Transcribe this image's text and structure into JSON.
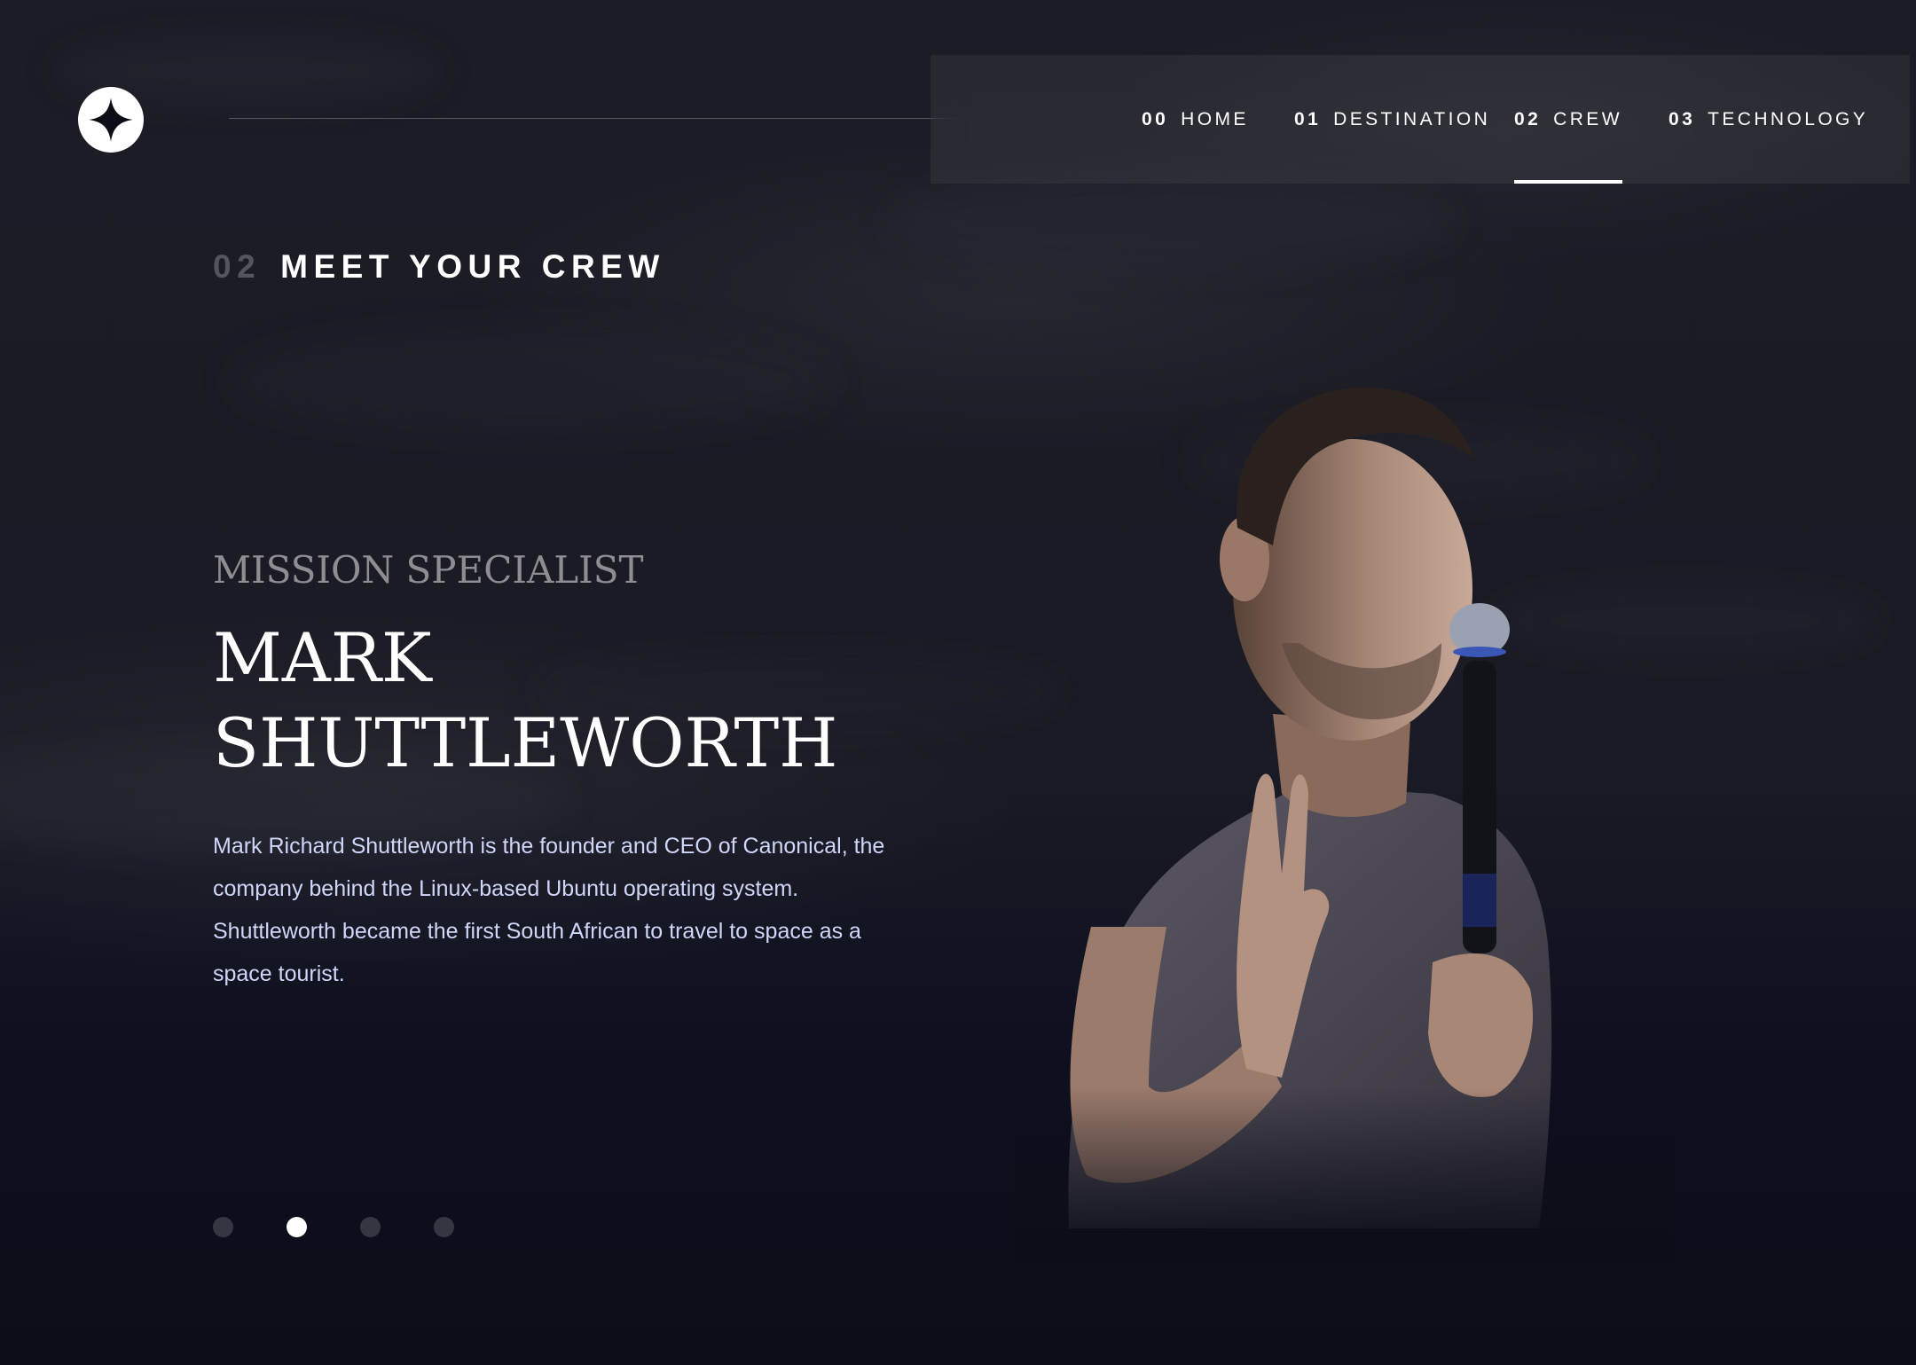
{
  "header": {
    "logo_icon": "four-point-star-icon",
    "nav": [
      {
        "num": "00",
        "label": "HOME",
        "active": false
      },
      {
        "num": "01",
        "label": "DESTINATION",
        "active": false
      },
      {
        "num": "02",
        "label": "CREW",
        "active": true
      },
      {
        "num": "03",
        "label": "TECHNOLOGY",
        "active": false
      }
    ]
  },
  "section": {
    "num": "02",
    "title": "MEET YOUR CREW"
  },
  "crew": {
    "role": "MISSION SPECIALIST",
    "name": "MARK SHUTTLEWORTH",
    "bio": "Mark Richard Shuttleworth is the founder and CEO of Canonical, the company behind the Linux-based Ubuntu operating system. Shuttleworth became the first South African to travel to space as a space tourist."
  },
  "carousel": {
    "count": 4,
    "active_index": 1
  },
  "colors": {
    "background": "#0b0d17",
    "text": "#ffffff",
    "body_text": "#d0d6f9",
    "muted": "#ffffff40"
  }
}
